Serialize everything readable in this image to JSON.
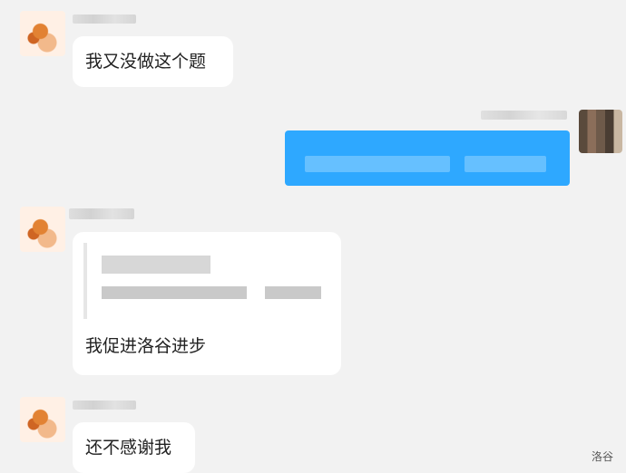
{
  "messages": [
    {
      "side": "left",
      "text": "我又没做这个题"
    },
    {
      "side": "right",
      "text": ""
    },
    {
      "side": "left",
      "text": "我促进洛谷进步"
    },
    {
      "side": "left",
      "text": "还不感谢我"
    }
  ],
  "watermark": "洛谷",
  "colors": {
    "background": "#f2f2f2",
    "bubble": "#ffffff",
    "outgoing": "#2ea8ff"
  }
}
